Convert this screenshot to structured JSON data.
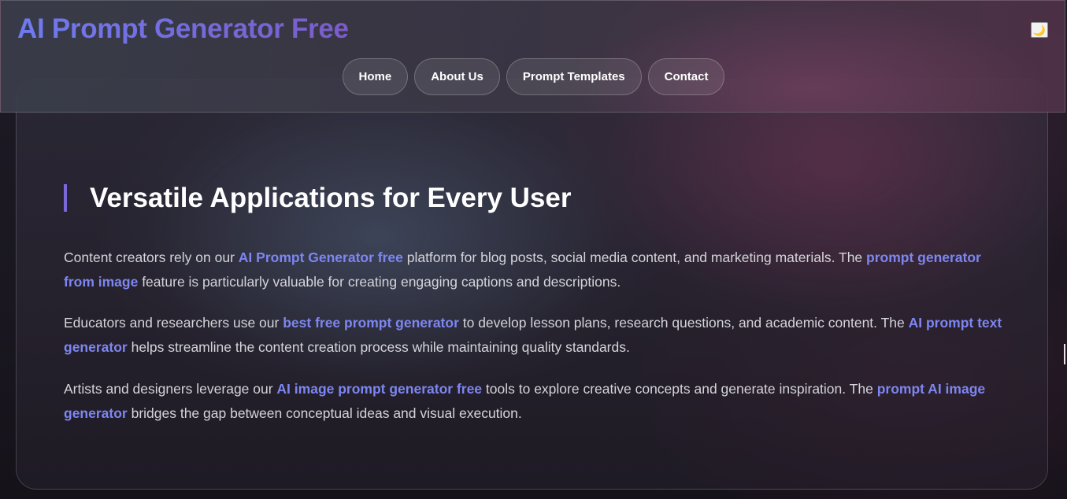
{
  "header": {
    "brand": "AI Prompt Generator Free",
    "theme_toggle_icon": "moon-icon",
    "theme_toggle_glyph": "🌙",
    "nav": [
      {
        "label": "Home"
      },
      {
        "label": "About Us"
      },
      {
        "label": "Prompt Templates"
      },
      {
        "label": "Contact"
      }
    ]
  },
  "section": {
    "title": "Versatile Applications for Every User",
    "paragraphs": [
      {
        "t1": "Content creators rely on our ",
        "l1": "AI Prompt Generator free",
        "t2": " platform for blog posts, social media content, and marketing materials. The ",
        "l2": "prompt generator from image",
        "t3": " feature is particularly valuable for creating engaging captions and descriptions."
      },
      {
        "t1": "Educators and researchers use our ",
        "l1": "best free prompt generator",
        "t2": " to develop lesson plans, research questions, and academic content. The ",
        "l2": "AI prompt text generator",
        "t3": " helps streamline the content creation process while maintaining quality standards."
      },
      {
        "t1": "Artists and designers leverage our ",
        "l1": "AI image prompt generator free",
        "t2": " tools to explore creative concepts and generate inspiration. The ",
        "l2": "prompt AI image generator",
        "t3": " bridges the gap between conceptual ideas and visual execution."
      }
    ]
  },
  "colors": {
    "brand_gradient_start": "#6f7bf0",
    "brand_gradient_end": "#7a5cc9",
    "link": "#7d86f1",
    "title_accent": "#7b68d8",
    "body_text": "#d4d4da"
  }
}
